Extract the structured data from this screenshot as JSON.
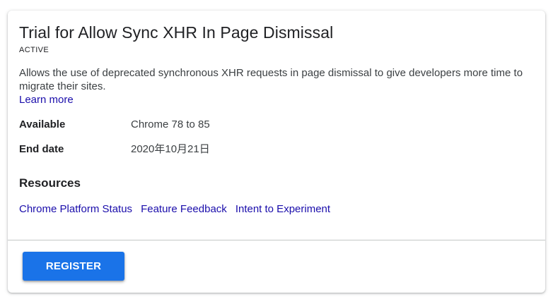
{
  "trial": {
    "title": "Trial for Allow Sync XHR In Page Dismissal",
    "status": "ACTIVE",
    "description": "Allows the use of deprecated synchronous XHR requests in page dismissal to give developers more time to migrate their sites.",
    "learn_more_label": "Learn more"
  },
  "details": {
    "available_label": "Available",
    "available_value": "Chrome 78 to 85",
    "end_date_label": "End date",
    "end_date_value": "2020年10月21日"
  },
  "resources": {
    "heading": "Resources",
    "links": [
      "Chrome Platform Status",
      "Feature Feedback",
      "Intent to Experiment"
    ]
  },
  "actions": {
    "register_label": "REGISTER"
  },
  "colors": {
    "link": "#1a0dab",
    "primary_button": "#1a73e8",
    "divider": "#c4c7c5"
  }
}
